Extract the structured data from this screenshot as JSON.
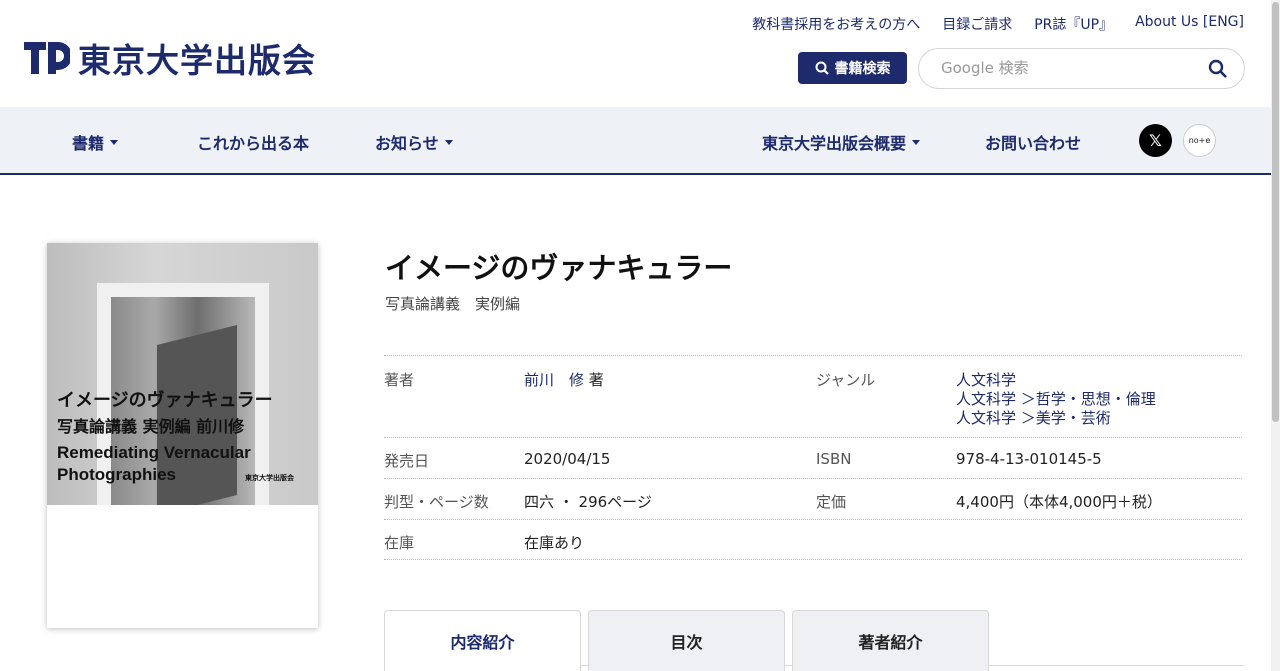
{
  "header": {
    "logo_text": "東京大学出版会",
    "top_links": [
      "教科書採用をお考えの方へ",
      "目録ご請求",
      "PR誌『UP』",
      "About Us [ENG]"
    ],
    "search_button_label": "書籍検索",
    "google_placeholder": "Google 検索"
  },
  "nav": {
    "items": [
      "書籍",
      "これから出る本",
      "お知らせ",
      "東京大学出版会概要",
      "お問い合わせ"
    ],
    "sns_x": "𝕏",
    "sns_note": "no+e"
  },
  "cover": {
    "title_jp": "イメージのヴァナキュラー",
    "subtitle_jp": "写真論講義 実例編 前川修",
    "title_en_1": "Remediating Vernacular",
    "title_en_2": "Photographies",
    "publisher": "東京大学出版会"
  },
  "book": {
    "title": "イメージのヴァナキュラー",
    "subtitle": "写真論講義　実例編"
  },
  "info": {
    "author_label": "著者",
    "author_name": "前川　修",
    "author_suffix": "著",
    "genre_label": "ジャンル",
    "genres": [
      "人文科学",
      "人文科学 ＞哲学・思想・倫理",
      "人文科学 ＞美学・芸術"
    ],
    "release_label": "発売日",
    "release_value": "2020/04/15",
    "isbn_label": "ISBN",
    "isbn_value": "978-4-13-010145-5",
    "format_label": "判型・ページ数",
    "format_value": "四六 ・ 296ページ",
    "price_label": "定価",
    "price_value": "4,400円（本体4,000円＋税）",
    "stock_label": "在庫",
    "stock_value": "在庫あり"
  },
  "tabs": [
    "内容紹介",
    "目次",
    "著者紹介"
  ],
  "colors": {
    "brand": "#1d2a6b",
    "nav_bg": "#eef1f5"
  }
}
